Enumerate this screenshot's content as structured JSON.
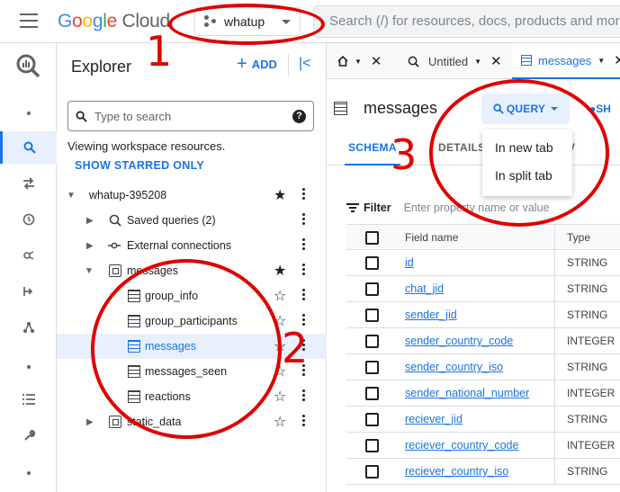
{
  "topbar": {
    "logo_google": [
      "G",
      "o",
      "o",
      "g",
      "l",
      "e"
    ],
    "logo_cloud": "Cloud",
    "project": "whatup",
    "search_placeholder": "Search (/) for resources, docs, products and more"
  },
  "explorer": {
    "title": "Explorer",
    "add_label": "ADD",
    "search_placeholder": "Type to search",
    "workspace_text": "Viewing workspace resources.",
    "show_starred": "SHOW STARRED ONLY",
    "tree": {
      "project": "whatup-395208",
      "saved_queries": "Saved queries (2)",
      "external_connections": "External connections",
      "dataset": "messages",
      "tables": [
        "group_info",
        "group_participants",
        "messages",
        "messages_seen",
        "reactions"
      ],
      "static_data": "static_data"
    }
  },
  "main": {
    "tabs": [
      {
        "label": ""
      },
      {
        "label": "Untitled"
      },
      {
        "label": "messages"
      }
    ],
    "table_name": "messages",
    "query_button": "QUERY",
    "share_button": "SH",
    "subtabs": [
      "SCHEMA",
      "DETAILS",
      "V"
    ],
    "query_menu": [
      "In new tab",
      "In split tab"
    ],
    "filter_label": "Filter",
    "filter_placeholder": "Enter property name or value",
    "schema": {
      "headers": [
        "Field name",
        "Type"
      ],
      "rows": [
        {
          "name": "id",
          "type": "STRING"
        },
        {
          "name": "chat_jid",
          "type": "STRING"
        },
        {
          "name": "sender_jid",
          "type": "STRING"
        },
        {
          "name": "sender_country_code",
          "type": "INTEGER"
        },
        {
          "name": "sender_country_iso",
          "type": "STRING"
        },
        {
          "name": "sender_national_number",
          "type": "INTEGER"
        },
        {
          "name": "reciever_jid",
          "type": "STRING"
        },
        {
          "name": "reciever_country_code",
          "type": "INTEGER"
        },
        {
          "name": "reciever_country_iso",
          "type": "STRING"
        }
      ]
    }
  },
  "annotations": [
    "1",
    "2",
    "3"
  ],
  "colors": {
    "accent": "#1a73e8",
    "annotation": "#e00000",
    "selected_bg": "#e8f0fe"
  }
}
